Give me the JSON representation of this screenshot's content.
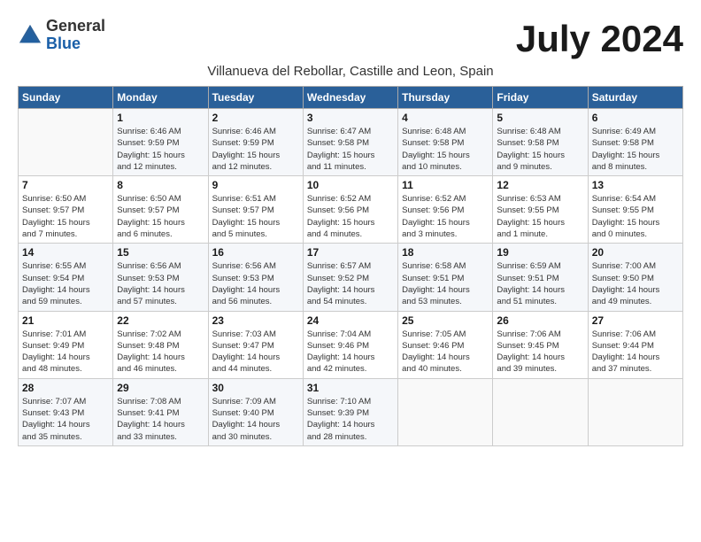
{
  "header": {
    "logo_general": "General",
    "logo_blue": "Blue",
    "month_year": "July 2024",
    "location": "Villanueva del Rebollar, Castille and Leon, Spain"
  },
  "days_of_week": [
    "Sunday",
    "Monday",
    "Tuesday",
    "Wednesday",
    "Thursday",
    "Friday",
    "Saturday"
  ],
  "weeks": [
    [
      {
        "day": "",
        "info": ""
      },
      {
        "day": "1",
        "info": "Sunrise: 6:46 AM\nSunset: 9:59 PM\nDaylight: 15 hours\nand 12 minutes."
      },
      {
        "day": "2",
        "info": "Sunrise: 6:46 AM\nSunset: 9:59 PM\nDaylight: 15 hours\nand 12 minutes."
      },
      {
        "day": "3",
        "info": "Sunrise: 6:47 AM\nSunset: 9:58 PM\nDaylight: 15 hours\nand 11 minutes."
      },
      {
        "day": "4",
        "info": "Sunrise: 6:48 AM\nSunset: 9:58 PM\nDaylight: 15 hours\nand 10 minutes."
      },
      {
        "day": "5",
        "info": "Sunrise: 6:48 AM\nSunset: 9:58 PM\nDaylight: 15 hours\nand 9 minutes."
      },
      {
        "day": "6",
        "info": "Sunrise: 6:49 AM\nSunset: 9:58 PM\nDaylight: 15 hours\nand 8 minutes."
      }
    ],
    [
      {
        "day": "7",
        "info": "Sunrise: 6:50 AM\nSunset: 9:57 PM\nDaylight: 15 hours\nand 7 minutes."
      },
      {
        "day": "8",
        "info": "Sunrise: 6:50 AM\nSunset: 9:57 PM\nDaylight: 15 hours\nand 6 minutes."
      },
      {
        "day": "9",
        "info": "Sunrise: 6:51 AM\nSunset: 9:57 PM\nDaylight: 15 hours\nand 5 minutes."
      },
      {
        "day": "10",
        "info": "Sunrise: 6:52 AM\nSunset: 9:56 PM\nDaylight: 15 hours\nand 4 minutes."
      },
      {
        "day": "11",
        "info": "Sunrise: 6:52 AM\nSunset: 9:56 PM\nDaylight: 15 hours\nand 3 minutes."
      },
      {
        "day": "12",
        "info": "Sunrise: 6:53 AM\nSunset: 9:55 PM\nDaylight: 15 hours\nand 1 minute."
      },
      {
        "day": "13",
        "info": "Sunrise: 6:54 AM\nSunset: 9:55 PM\nDaylight: 15 hours\nand 0 minutes."
      }
    ],
    [
      {
        "day": "14",
        "info": "Sunrise: 6:55 AM\nSunset: 9:54 PM\nDaylight: 14 hours\nand 59 minutes."
      },
      {
        "day": "15",
        "info": "Sunrise: 6:56 AM\nSunset: 9:53 PM\nDaylight: 14 hours\nand 57 minutes."
      },
      {
        "day": "16",
        "info": "Sunrise: 6:56 AM\nSunset: 9:53 PM\nDaylight: 14 hours\nand 56 minutes."
      },
      {
        "day": "17",
        "info": "Sunrise: 6:57 AM\nSunset: 9:52 PM\nDaylight: 14 hours\nand 54 minutes."
      },
      {
        "day": "18",
        "info": "Sunrise: 6:58 AM\nSunset: 9:51 PM\nDaylight: 14 hours\nand 53 minutes."
      },
      {
        "day": "19",
        "info": "Sunrise: 6:59 AM\nSunset: 9:51 PM\nDaylight: 14 hours\nand 51 minutes."
      },
      {
        "day": "20",
        "info": "Sunrise: 7:00 AM\nSunset: 9:50 PM\nDaylight: 14 hours\nand 49 minutes."
      }
    ],
    [
      {
        "day": "21",
        "info": "Sunrise: 7:01 AM\nSunset: 9:49 PM\nDaylight: 14 hours\nand 48 minutes."
      },
      {
        "day": "22",
        "info": "Sunrise: 7:02 AM\nSunset: 9:48 PM\nDaylight: 14 hours\nand 46 minutes."
      },
      {
        "day": "23",
        "info": "Sunrise: 7:03 AM\nSunset: 9:47 PM\nDaylight: 14 hours\nand 44 minutes."
      },
      {
        "day": "24",
        "info": "Sunrise: 7:04 AM\nSunset: 9:46 PM\nDaylight: 14 hours\nand 42 minutes."
      },
      {
        "day": "25",
        "info": "Sunrise: 7:05 AM\nSunset: 9:46 PM\nDaylight: 14 hours\nand 40 minutes."
      },
      {
        "day": "26",
        "info": "Sunrise: 7:06 AM\nSunset: 9:45 PM\nDaylight: 14 hours\nand 39 minutes."
      },
      {
        "day": "27",
        "info": "Sunrise: 7:06 AM\nSunset: 9:44 PM\nDaylight: 14 hours\nand 37 minutes."
      }
    ],
    [
      {
        "day": "28",
        "info": "Sunrise: 7:07 AM\nSunset: 9:43 PM\nDaylight: 14 hours\nand 35 minutes."
      },
      {
        "day": "29",
        "info": "Sunrise: 7:08 AM\nSunset: 9:41 PM\nDaylight: 14 hours\nand 33 minutes."
      },
      {
        "day": "30",
        "info": "Sunrise: 7:09 AM\nSunset: 9:40 PM\nDaylight: 14 hours\nand 30 minutes."
      },
      {
        "day": "31",
        "info": "Sunrise: 7:10 AM\nSunset: 9:39 PM\nDaylight: 14 hours\nand 28 minutes."
      },
      {
        "day": "",
        "info": ""
      },
      {
        "day": "",
        "info": ""
      },
      {
        "day": "",
        "info": ""
      }
    ]
  ]
}
